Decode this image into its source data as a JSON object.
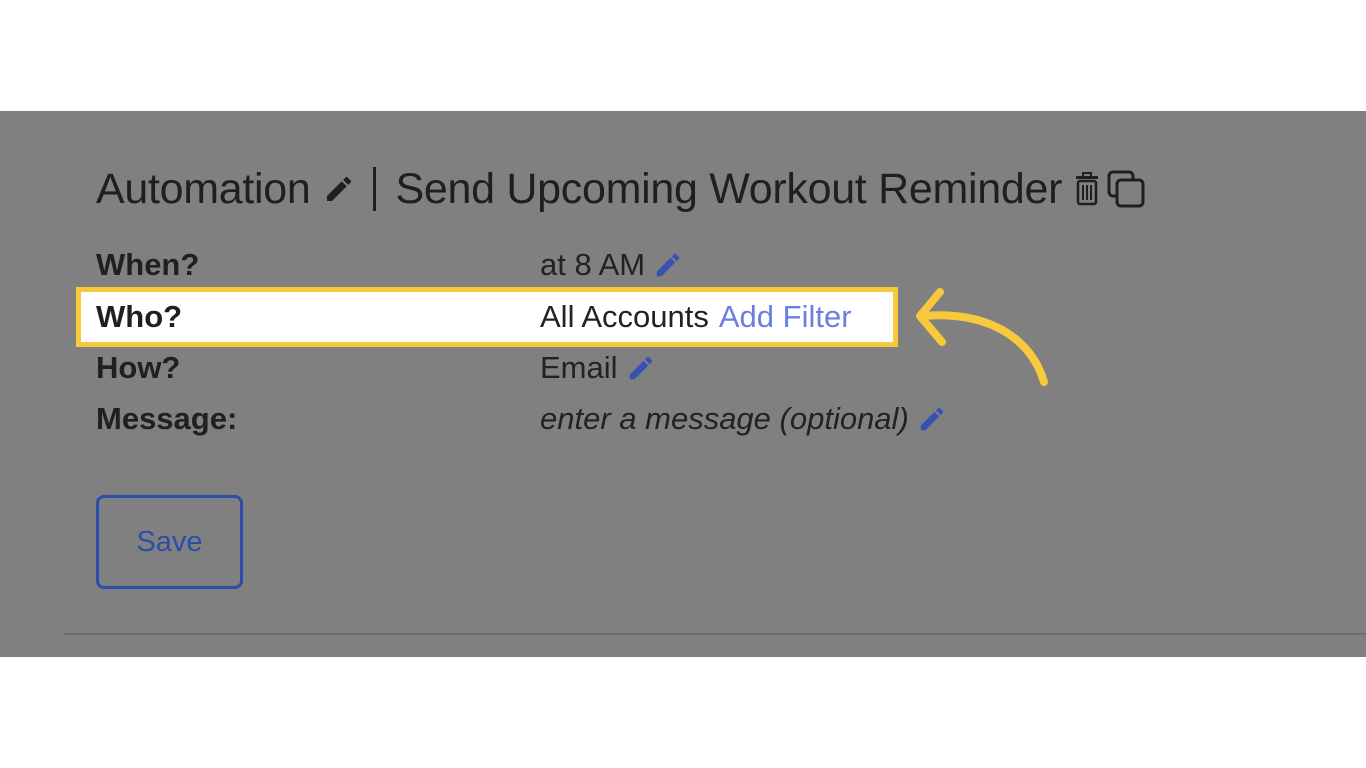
{
  "header": {
    "title_prefix": "Automation",
    "separator": "|",
    "title_name": "Send Upcoming Workout Reminder",
    "icons": [
      "pencil-icon",
      "trash-icon",
      "copy-icon"
    ]
  },
  "rows": [
    {
      "label": "When?",
      "value": "at 8 AM",
      "icon": "pencil-icon"
    },
    {
      "label": "Who?",
      "value": "All Accounts",
      "link": "Add Filter"
    },
    {
      "label": "How?",
      "value": "Email",
      "icon": "pencil-icon"
    },
    {
      "label": "Message:",
      "placeholder": "enter a message (optional)",
      "icon": "pencil-icon"
    }
  ],
  "actions": {
    "save_label": "Save"
  },
  "colors": {
    "overlay": "#808080",
    "highlight_border": "#f8c93c",
    "link": "#6b7fe0",
    "button_border": "#2e4da8",
    "arrow": "#f8c93c"
  }
}
